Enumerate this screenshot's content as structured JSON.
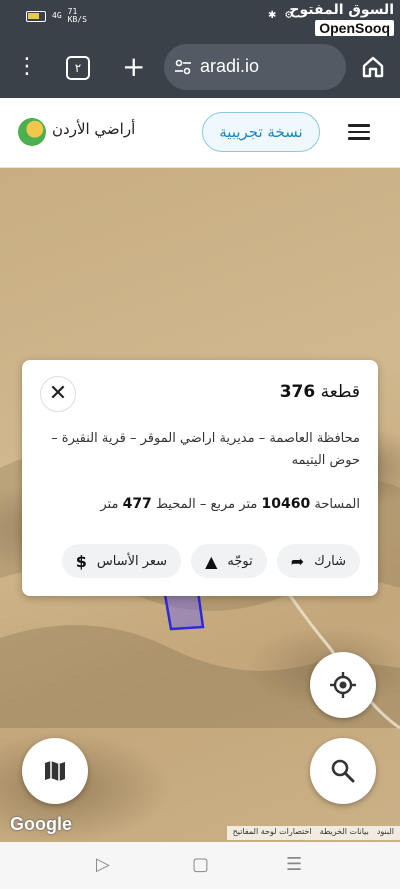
{
  "status": {
    "speed": "71\nKB/S",
    "signal": "4G",
    "watermark_ar": "السوق المفتوح",
    "watermark_en": "OpenSooq"
  },
  "browser": {
    "tabs_count": "٢",
    "url": "aradi.io"
  },
  "header": {
    "brand": "أراضي الأردن",
    "trial_label": "نسخة تجريبية"
  },
  "card": {
    "title_prefix": "قطعة",
    "parcel_number": "376",
    "location": "محافظة العاصمة – مديرية اراضي الموقر – قرية النقيرة – حوض اليتيمه",
    "area_label": "المساحة",
    "area_value": "10460",
    "area_unit": "متر مربع",
    "perimeter_label": "– المحيط",
    "perimeter_value": "477",
    "perimeter_unit": "متر",
    "share_label": "شارك",
    "direction_label": "توجّه",
    "price_label": "سعر الأساس"
  },
  "map": {
    "google_label": "Google",
    "attrib_terms": "البنود",
    "attrib_data": "بيانات الخريطة",
    "attrib_shortcuts": "اختصارات لوحة المفاتيح"
  },
  "colors": {
    "parcel_stroke": "#2e2adb",
    "parcel_fill": "rgba(110,100,235,0.45)",
    "trial_text": "#1d86c2"
  }
}
